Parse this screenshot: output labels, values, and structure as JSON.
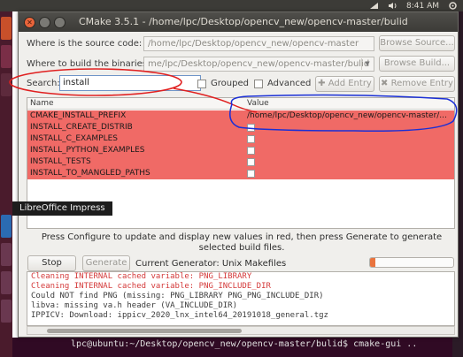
{
  "panel": {
    "clock": "8:41 AM"
  },
  "window": {
    "title": "CMake 3.5.1 - /home/lpc/Desktop/opencv_new/opencv-master/bulid"
  },
  "source": {
    "label": "Where is the source code:",
    "value": "/home/lpc/Desktop/opencv_new/opencv-master",
    "browse": "Browse Source..."
  },
  "build": {
    "label": "Where to build the binaries:",
    "value": "me/lpc/Desktop/opencv_new/opencv-master/bulid",
    "browse": "Browse Build..."
  },
  "search": {
    "label": "Search:",
    "value": "install",
    "grouped": "Grouped",
    "advanced": "Advanced",
    "add_entry": "Add Entry",
    "remove_entry": "Remove Entry"
  },
  "table": {
    "col_name": "Name",
    "col_value": "Value",
    "rows": [
      {
        "name": "CMAKE_INSTALL_PREFIX",
        "value": "/home/lpc/Desktop/opencv_new/opencv-master/..."
      },
      {
        "name": "INSTALL_CREATE_DISTRIB",
        "value": ""
      },
      {
        "name": "INSTALL_C_EXAMPLES",
        "value": ""
      },
      {
        "name": "INSTALL_PYTHON_EXAMPLES",
        "value": ""
      },
      {
        "name": "INSTALL_TESTS",
        "value": ""
      },
      {
        "name": "INSTALL_TO_MANGLED_PATHS",
        "value": ""
      }
    ]
  },
  "tooltip": "LibreOffice Impress",
  "info": "Press Configure to update and display new values in red, then press Generate to generate selected build files.",
  "buttons": {
    "stop": "Stop",
    "generate": "Generate"
  },
  "generator": "Current Generator: Unix Makefiles",
  "progress": 0.06,
  "log": [
    {
      "text": "Cleaning INTERNAL cached variable: PNG_LIBRARY",
      "red": true
    },
    {
      "text": "Cleaning INTERNAL cached variable: PNG_INCLUDE_DIR",
      "red": true
    },
    {
      "text": "Could NOT find PNG (missing:  PNG_LIBRARY PNG_PNG_INCLUDE_DIR)",
      "red": false
    },
    {
      "text": "libva: missing va.h header (VA_INCLUDE_DIR)",
      "red": false
    },
    {
      "text": "IPPICV: Download: ippicv_2020_lnx_intel64_20191018_general.tgz",
      "red": false
    }
  ],
  "terminal": "lpc@ubuntu:~/Desktop/opencv_new/opencv-master/bulid$ cmake-gui ..",
  "colors": {
    "changed_row": "#f06a66",
    "titlebar": "#3c3b37",
    "annotation_red": "#e02020",
    "annotation_blue": "#1a2fd6"
  }
}
